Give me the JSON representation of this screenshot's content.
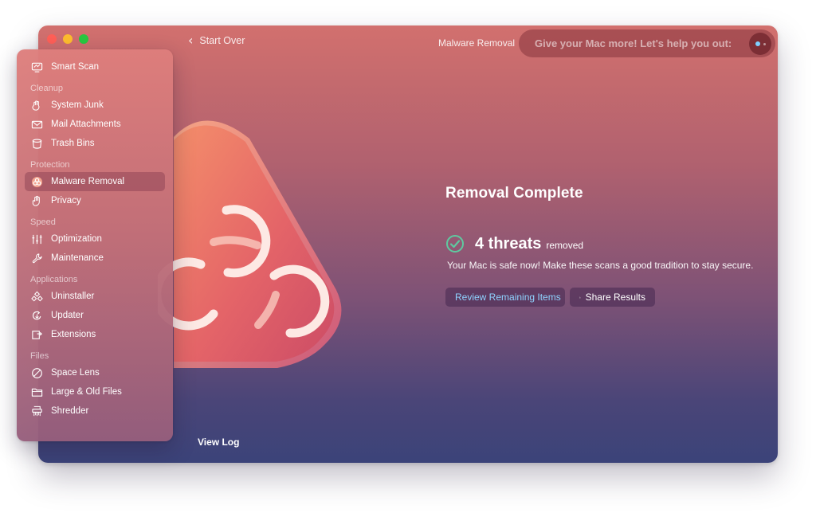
{
  "window": {
    "title": "Malware Removal",
    "start_over": "Start Over",
    "promo_text": "Give your Mac more! Let's help you out:",
    "view_log": "View Log"
  },
  "sidebar": {
    "smart_scan": "Smart Scan",
    "sections": {
      "cleanup": "Cleanup",
      "protection": "Protection",
      "speed": "Speed",
      "applications": "Applications",
      "files": "Files"
    },
    "items": {
      "system_junk": "System Junk",
      "mail_attachments": "Mail Attachments",
      "trash_bins": "Trash Bins",
      "malware_removal": "Malware Removal",
      "privacy": "Privacy",
      "optimization": "Optimization",
      "maintenance": "Maintenance",
      "uninstaller": "Uninstaller",
      "updater": "Updater",
      "extensions": "Extensions",
      "space_lens": "Space Lens",
      "large_old_files": "Large & Old Files",
      "shredder": "Shredder"
    },
    "active_item": "Malware Removal"
  },
  "result": {
    "heading": "Removal Complete",
    "threat_count": "4 threats",
    "threat_suffix": "removed",
    "message": "Your Mac is safe now! Make these scans a good tradition to stay secure.",
    "review_button": "Review Remaining Items",
    "share_button": "Share Results"
  },
  "colors": {
    "accent_link": "#8fd3ff",
    "check_green": "#5fc9a0",
    "hero_coral": "#f08066",
    "window_top": "#d2706e",
    "window_bottom": "#3b4379"
  },
  "icons": {
    "smart_scan": "monitor-icon",
    "system_junk": "bin-hand-icon",
    "mail_attachments": "envelope-icon",
    "trash_bins": "trash-icon",
    "malware_removal": "biohazard-icon",
    "privacy": "hand-icon",
    "optimization": "sliders-icon",
    "maintenance": "wrench-icon",
    "uninstaller": "apps-icon",
    "updater": "update-icon",
    "extensions": "extension-icon",
    "space_lens": "lens-icon",
    "large_old_files": "folder-icon",
    "shredder": "shredder-icon"
  }
}
